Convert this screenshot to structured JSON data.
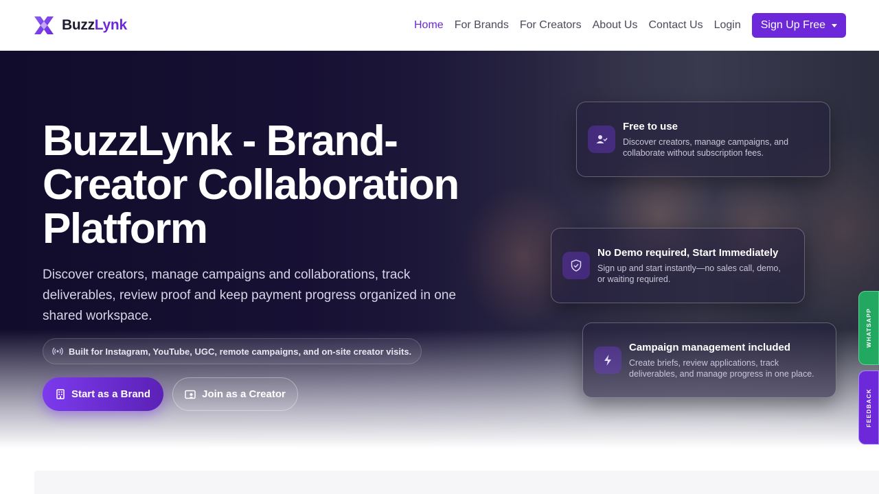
{
  "brand": {
    "name_part1": "Buzz",
    "name_part2": "Lynk",
    "logo_icon": "x-logo-icon",
    "color": "#6d28d9"
  },
  "nav": {
    "items": [
      {
        "label": "Home",
        "active": true
      },
      {
        "label": "For Brands",
        "active": false
      },
      {
        "label": "For Creators",
        "active": false
      },
      {
        "label": "About Us",
        "active": false
      },
      {
        "label": "Contact Us",
        "active": false
      },
      {
        "label": "Login",
        "active": false
      }
    ],
    "signup_label": "Sign Up Free"
  },
  "hero": {
    "title": "BuzzLynk - Brand-Creator Collaboration Platform",
    "subtitle": "Discover creators, manage campaigns and collaborations, track deliverables, review proof and keep payment progress organized in one shared workspace.",
    "platforms_note": "Built for Instagram, YouTube, UGC, remote campaigns, and on-site creator visits.",
    "platforms_icon": "broadcast-icon",
    "cta_brand": {
      "label": "Start as a Brand",
      "icon": "building-icon"
    },
    "cta_creator": {
      "label": "Join as a Creator",
      "icon": "creator-card-icon"
    }
  },
  "features": [
    {
      "icon": "user-check-icon",
      "title": "Free to use",
      "description": "Discover creators, manage campaigns, and collaborate without subscription fees."
    },
    {
      "icon": "shield-check-icon",
      "title": "No Demo required, Start Immediately",
      "description": "Sign up and start instantly—no sales call, demo, or waiting required."
    },
    {
      "icon": "lightning-icon",
      "title": "Campaign management included",
      "description": "Create briefs, review applications, track deliverables, and manage progress in one place."
    }
  ],
  "side_tabs": {
    "whatsapp": "WHATSAPP",
    "feedback": "FEEDBACK"
  },
  "colors": {
    "accent": "#6d28d9",
    "whatsapp": "#22a861"
  }
}
